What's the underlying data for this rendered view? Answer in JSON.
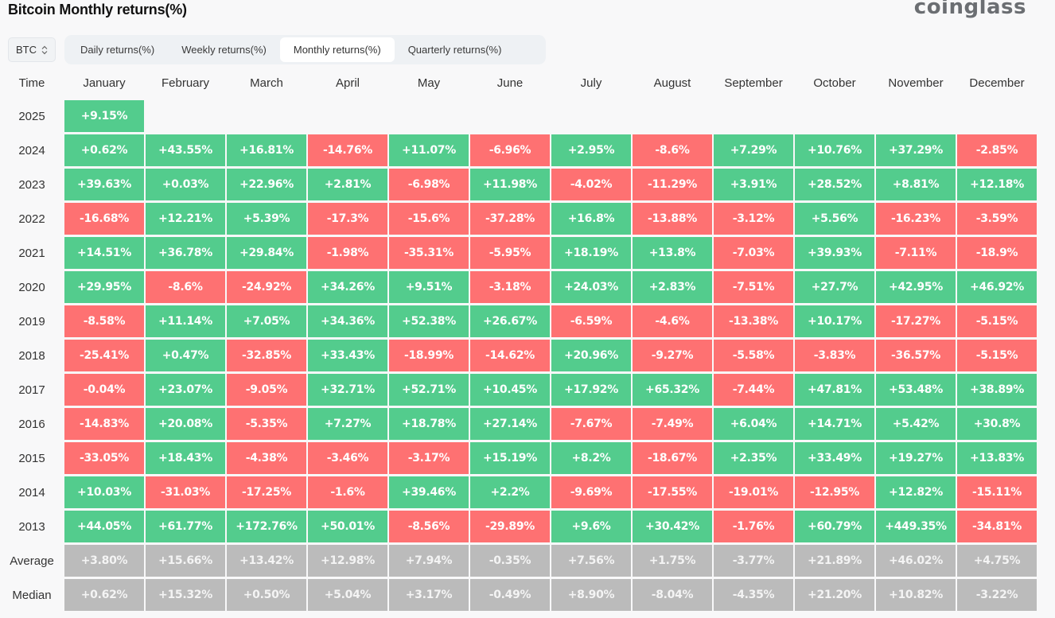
{
  "header": {
    "title": "Bitcoin Monthly returns(%)",
    "brand": "coinglass"
  },
  "controls": {
    "coin_select": "BTC",
    "tabs": [
      {
        "label": "Daily returns(%)",
        "active": false
      },
      {
        "label": "Weekly returns(%)",
        "active": false
      },
      {
        "label": "Monthly returns(%)",
        "active": true
      },
      {
        "label": "Quarterly returns(%)",
        "active": false
      }
    ]
  },
  "colors": {
    "positive": "#53cc8d",
    "negative": "#fe7172",
    "stat": "#bbbbbb"
  },
  "chart_data": {
    "type": "heatmap",
    "title": "Bitcoin Monthly returns(%)",
    "row_header": "Time",
    "columns": [
      "January",
      "February",
      "March",
      "April",
      "May",
      "June",
      "July",
      "August",
      "September",
      "October",
      "November",
      "December"
    ],
    "rows": [
      {
        "label": "2025",
        "values": [
          "+9.15%",
          null,
          null,
          null,
          null,
          null,
          null,
          null,
          null,
          null,
          null,
          null
        ]
      },
      {
        "label": "2024",
        "values": [
          "+0.62%",
          "+43.55%",
          "+16.81%",
          "-14.76%",
          "+11.07%",
          "-6.96%",
          "+2.95%",
          "-8.6%",
          "+7.29%",
          "+10.76%",
          "+37.29%",
          "-2.85%"
        ]
      },
      {
        "label": "2023",
        "values": [
          "+39.63%",
          "+0.03%",
          "+22.96%",
          "+2.81%",
          "-6.98%",
          "+11.98%",
          "-4.02%",
          "-11.29%",
          "+3.91%",
          "+28.52%",
          "+8.81%",
          "+12.18%"
        ]
      },
      {
        "label": "2022",
        "values": [
          "-16.68%",
          "+12.21%",
          "+5.39%",
          "-17.3%",
          "-15.6%",
          "-37.28%",
          "+16.8%",
          "-13.88%",
          "-3.12%",
          "+5.56%",
          "-16.23%",
          "-3.59%"
        ]
      },
      {
        "label": "2021",
        "values": [
          "+14.51%",
          "+36.78%",
          "+29.84%",
          "-1.98%",
          "-35.31%",
          "-5.95%",
          "+18.19%",
          "+13.8%",
          "-7.03%",
          "+39.93%",
          "-7.11%",
          "-18.9%"
        ]
      },
      {
        "label": "2020",
        "values": [
          "+29.95%",
          "-8.6%",
          "-24.92%",
          "+34.26%",
          "+9.51%",
          "-3.18%",
          "+24.03%",
          "+2.83%",
          "-7.51%",
          "+27.7%",
          "+42.95%",
          "+46.92%"
        ]
      },
      {
        "label": "2019",
        "values": [
          "-8.58%",
          "+11.14%",
          "+7.05%",
          "+34.36%",
          "+52.38%",
          "+26.67%",
          "-6.59%",
          "-4.6%",
          "-13.38%",
          "+10.17%",
          "-17.27%",
          "-5.15%"
        ]
      },
      {
        "label": "2018",
        "values": [
          "-25.41%",
          "+0.47%",
          "-32.85%",
          "+33.43%",
          "-18.99%",
          "-14.62%",
          "+20.96%",
          "-9.27%",
          "-5.58%",
          "-3.83%",
          "-36.57%",
          "-5.15%"
        ]
      },
      {
        "label": "2017",
        "values": [
          "-0.04%",
          "+23.07%",
          "-9.05%",
          "+32.71%",
          "+52.71%",
          "+10.45%",
          "+17.92%",
          "+65.32%",
          "-7.44%",
          "+47.81%",
          "+53.48%",
          "+38.89%"
        ]
      },
      {
        "label": "2016",
        "values": [
          "-14.83%",
          "+20.08%",
          "-5.35%",
          "+7.27%",
          "+18.78%",
          "+27.14%",
          "-7.67%",
          "-7.49%",
          "+6.04%",
          "+14.71%",
          "+5.42%",
          "+30.8%"
        ]
      },
      {
        "label": "2015",
        "values": [
          "-33.05%",
          "+18.43%",
          "-4.38%",
          "-3.46%",
          "-3.17%",
          "+15.19%",
          "+8.2%",
          "-18.67%",
          "+2.35%",
          "+33.49%",
          "+19.27%",
          "+13.83%"
        ]
      },
      {
        "label": "2014",
        "values": [
          "+10.03%",
          "-31.03%",
          "-17.25%",
          "-1.6%",
          "+39.46%",
          "+2.2%",
          "-9.69%",
          "-17.55%",
          "-19.01%",
          "-12.95%",
          "+12.82%",
          "-15.11%"
        ]
      },
      {
        "label": "2013",
        "values": [
          "+44.05%",
          "+61.77%",
          "+172.76%",
          "+50.01%",
          "-8.56%",
          "-29.89%",
          "+9.6%",
          "+30.42%",
          "-1.76%",
          "+60.79%",
          "+449.35%",
          "-34.81%"
        ]
      }
    ],
    "summary": [
      {
        "label": "Average",
        "values": [
          "+3.80%",
          "+15.66%",
          "+13.42%",
          "+12.98%",
          "+7.94%",
          "-0.35%",
          "+7.56%",
          "+1.75%",
          "-3.77%",
          "+21.89%",
          "+46.02%",
          "+4.75%"
        ]
      },
      {
        "label": "Median",
        "values": [
          "+0.62%",
          "+15.32%",
          "+0.50%",
          "+5.04%",
          "+3.17%",
          "-0.49%",
          "+8.90%",
          "-8.04%",
          "-4.35%",
          "+21.20%",
          "+10.82%",
          "-3.22%"
        ]
      }
    ]
  }
}
